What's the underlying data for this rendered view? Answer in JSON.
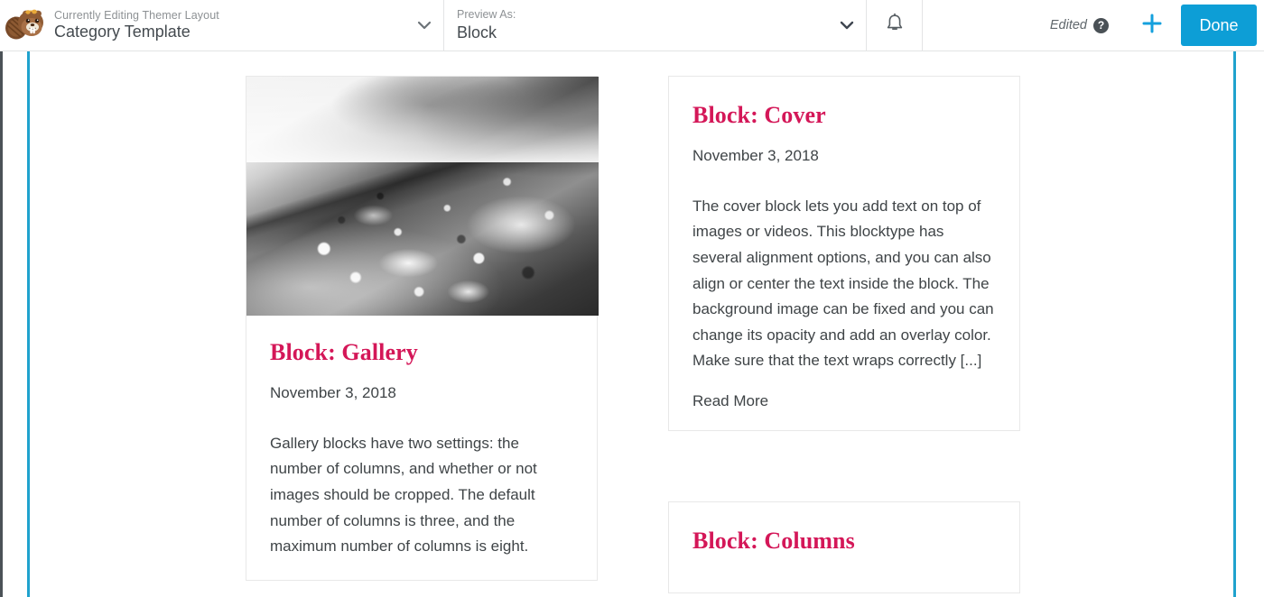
{
  "topbar": {
    "logo_icon": "beaver-logo-icon",
    "layout": {
      "eyebrow": "Currently Editing Themer Layout",
      "title": "Category Template",
      "chevron_icon": "chevron-down-icon"
    },
    "preview": {
      "eyebrow": "Preview As:",
      "value": "Block",
      "chevron_icon": "chevron-down-icon"
    },
    "bell_icon": "bell-icon",
    "edited_label": "Edited",
    "help_icon": "question-mark-icon",
    "help_glyph": "?",
    "plus_icon": "plus-icon",
    "done_label": "Done",
    "colors": {
      "accent": "#0d9ed6",
      "guide": "#1fa2cd",
      "heading_pink": "#d41758"
    }
  },
  "canvas": {
    "left_column": [
      {
        "has_image": true,
        "image_alt": "black and white photo of a weathered rusted curved metal hull",
        "title": "Block: Gallery",
        "date": "November 3, 2018",
        "excerpt": "Gallery blocks have two settings: the number of columns, and whether or not images should be cropped. The default number of columns is three, and the maximum number of columns is eight.",
        "read_more": ""
      }
    ],
    "right_column": [
      {
        "has_image": false,
        "title": "Block: Cover",
        "date": "November 3, 2018",
        "excerpt": "The cover block lets you add text on top of images or videos. This blocktype has several alignment options, and you can also align or center the text inside the block. The background image can be fixed and you can change its opacity and add an overlay color. Make sure that the text wraps correctly [...]",
        "read_more": "Read More"
      },
      {
        "has_image": false,
        "title": "Block: Columns",
        "date": "",
        "excerpt": "",
        "read_more": ""
      }
    ]
  }
}
